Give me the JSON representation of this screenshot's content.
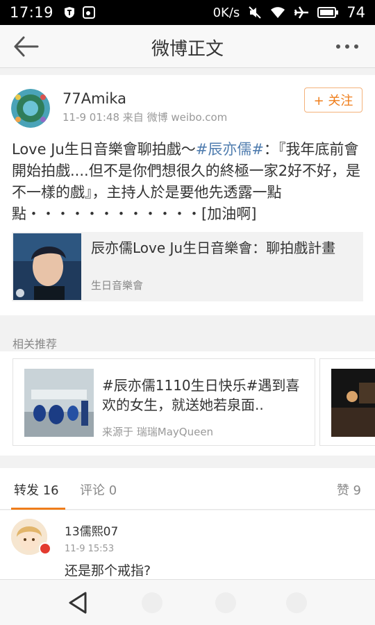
{
  "status_bar": {
    "time": "17:19",
    "network": "0K/s",
    "battery": "74"
  },
  "nav": {
    "title": "微博正文",
    "back_icon": "arrow-left-icon",
    "more_icon": "more-dots-icon"
  },
  "post": {
    "username": "77Amika",
    "meta": "11-9 01:48  来自 微博 weibo.com",
    "follow_label": "+ 关注",
    "text_before_topic": "Love Ju生日音樂會聊拍戲～",
    "topic": "#辰亦儒#",
    "text_after_topic": "：『我年底前會開始拍戲....但不是你們想很久的終極一家2好不好，是不一樣的戲』，主持人於是要他先透露一點點・・・・・・・・・・・・[加油啊]",
    "card": {
      "title": "辰亦儒Love Ju生日音樂會：聊拍戲計畫",
      "subtitle": "生日音樂會"
    }
  },
  "related": {
    "label": "相关推荐",
    "items": [
      {
        "title": "#辰亦儒1110生日快乐#遇到喜欢的女生，就送她若泉面..",
        "source": "来源于 瑞瑞MayQueen"
      }
    ]
  },
  "tabs": {
    "repost": "转发 16",
    "comment": "评论 0",
    "like": "赞 9"
  },
  "comment": {
    "name": "13儒熙07",
    "time": "11-9 15:53",
    "text": "还是那个戒指?"
  },
  "colors": {
    "accent": "#ef7d1a",
    "link": "#507daf"
  }
}
